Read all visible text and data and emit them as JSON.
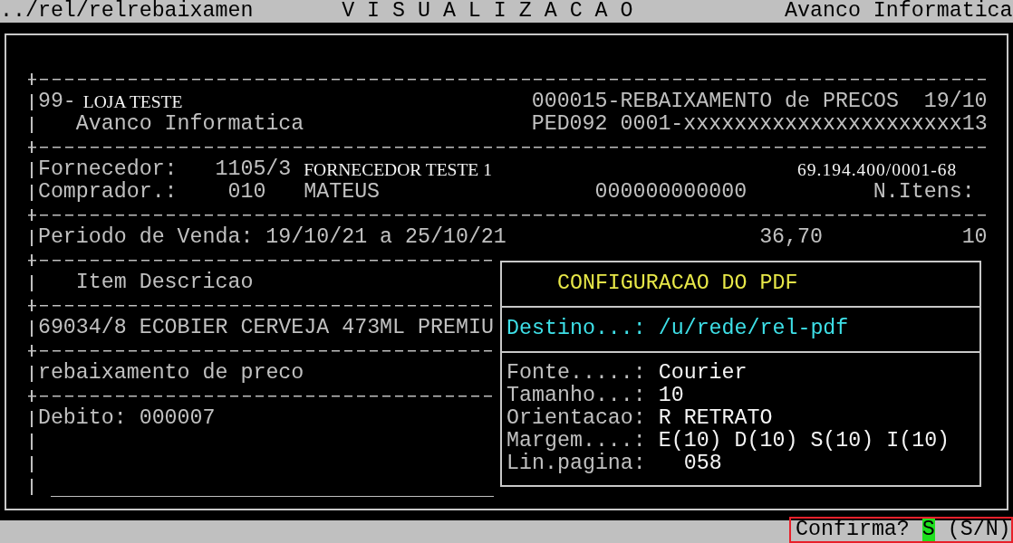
{
  "title_bar": {
    "path": "../rel/relrebaixamen",
    "title": "V I S U A L I Z A C A O",
    "company": "Avanco Informatica"
  },
  "report": {
    "store": {
      "code": "99-",
      "name": "LOJA TESTE"
    },
    "report_title": "000015-REBAIXAMENTO de PRECOS",
    "date": "19/10",
    "company": "Avanco Informatica",
    "order": "PED092 0001-xxxxxxxxxxxxxxxxxxxxxx13",
    "supplier": {
      "label": "Fornecedor:",
      "code": "1105/3",
      "name": "FORNECEDOR TESTE 1",
      "tax_id": "69.194.400/0001-68"
    },
    "buyer": {
      "label": "Comprador.:",
      "code": "010",
      "name": "MATEUS",
      "number": "000000000000",
      "items_label": "N.Itens:"
    },
    "period": {
      "label": "Periodo de Venda:",
      "dates": "19/10/21 a 25/10/21",
      "amount": "36,70",
      "items": "10"
    },
    "column_header": "Item Descricao",
    "item_line": "69034/8 ECOBIER CERVEJA 473ML PREMIU",
    "note": "rebaixamento de preco",
    "debit": {
      "label": "Debito:",
      "value": "000007"
    }
  },
  "pdf_dialog": {
    "title": "CONFIGURACAO DO PDF",
    "destination": {
      "label": "Destino...:",
      "value": "/u/rede/rel-pdf"
    },
    "fields": [
      {
        "kind": "text",
        "label": "Fonte.....:",
        "value": "Courier"
      },
      {
        "kind": "text",
        "label": "Tamanho...:",
        "value": "10"
      },
      {
        "kind": "text",
        "label": "Orientacao:",
        "value": "R RETRATO"
      },
      {
        "kind": "text",
        "label": "Margem....:",
        "value": "E(10) D(10) S(10) I(10)"
      },
      {
        "kind": "counter",
        "label": "Lin.pagina:",
        "value": "058"
      }
    ]
  },
  "status_bar": {
    "prompt": "Confirma?",
    "answer": "S",
    "options": "(S/N)",
    "highlighted": true
  }
}
